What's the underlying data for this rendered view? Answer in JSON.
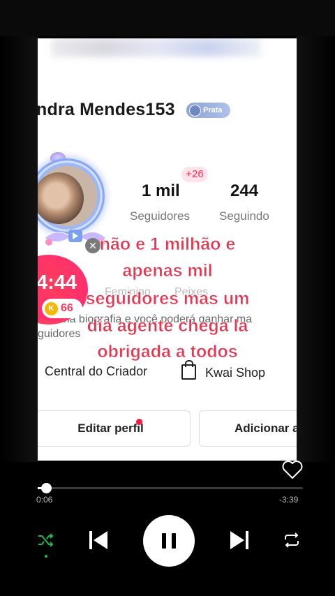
{
  "profile": {
    "name": "ndra Mendes153",
    "badge": "Prata",
    "followers_value": "1 mil",
    "followers_label": "Seguidores",
    "following_value": "244",
    "following_label": "Seguindo",
    "new_followers": "+26",
    "timer": "4:44",
    "coins": "66",
    "coin_symbol": "K",
    "gender": "Feminino",
    "sign": "Peixes",
    "bio_line1": "e uma biografia e você poderá ganhar ma",
    "bio_line2": "guidores",
    "creator_center": "Central do Criador",
    "shop": "Kwai Shop",
    "edit_profile": "Editar perfil",
    "add": "Adicionar a"
  },
  "overlay_text": [
    "não e 1 milhão e",
    "apenas mil",
    "seguidores mas um",
    "dia agente chega la",
    "obrigada a todos"
  ],
  "player": {
    "elapsed": "0:06",
    "remaining": "-3:39",
    "progress": 0.03,
    "shuffle_active": true,
    "accent": "#1db954"
  }
}
